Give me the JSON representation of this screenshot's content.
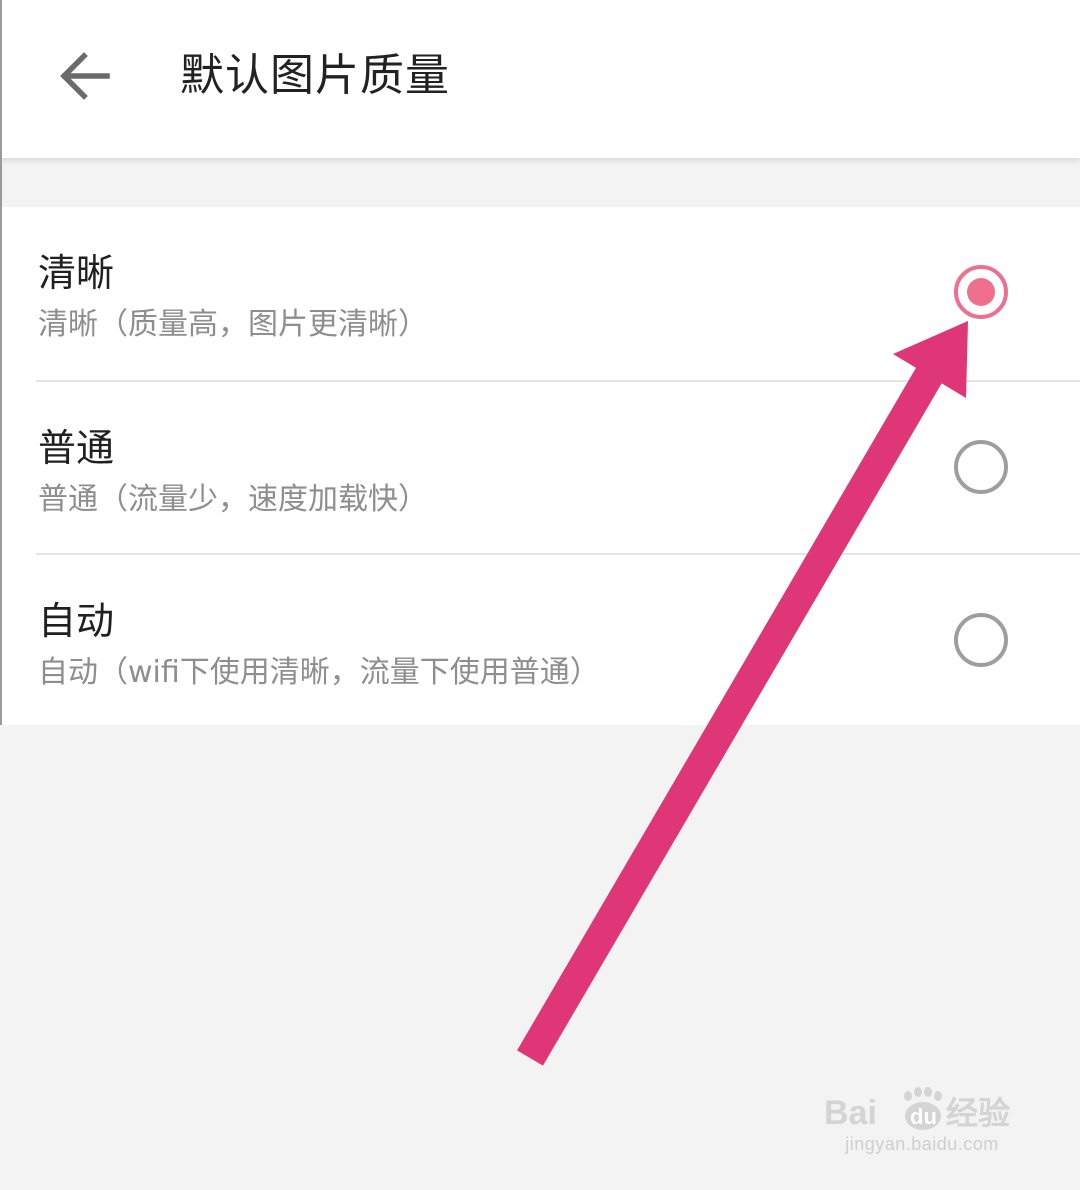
{
  "header": {
    "back_icon": "arrow-left-icon",
    "title": "默认图片质量"
  },
  "options": [
    {
      "title": "清晰",
      "description": "清晰（质量高，图片更清晰）",
      "selected": true
    },
    {
      "title": "普通",
      "description": "普通（流量少，速度加载快）",
      "selected": false
    },
    {
      "title": "自动",
      "description": "自动（wifi下使用清晰，流量下使用普通）",
      "selected": false
    }
  ],
  "annotation": {
    "type": "arrow",
    "color": "#de3677",
    "points_to": "option-0-radio"
  },
  "watermark": {
    "logo_text": "Baidu经验",
    "url": "jingyan.baidu.com"
  },
  "colors": {
    "accent": "#ef6f8e",
    "radio_off": "#9e9e9e",
    "title_text": "#222222",
    "desc_text": "#8e8e8e",
    "background": "#f3f3f3"
  }
}
